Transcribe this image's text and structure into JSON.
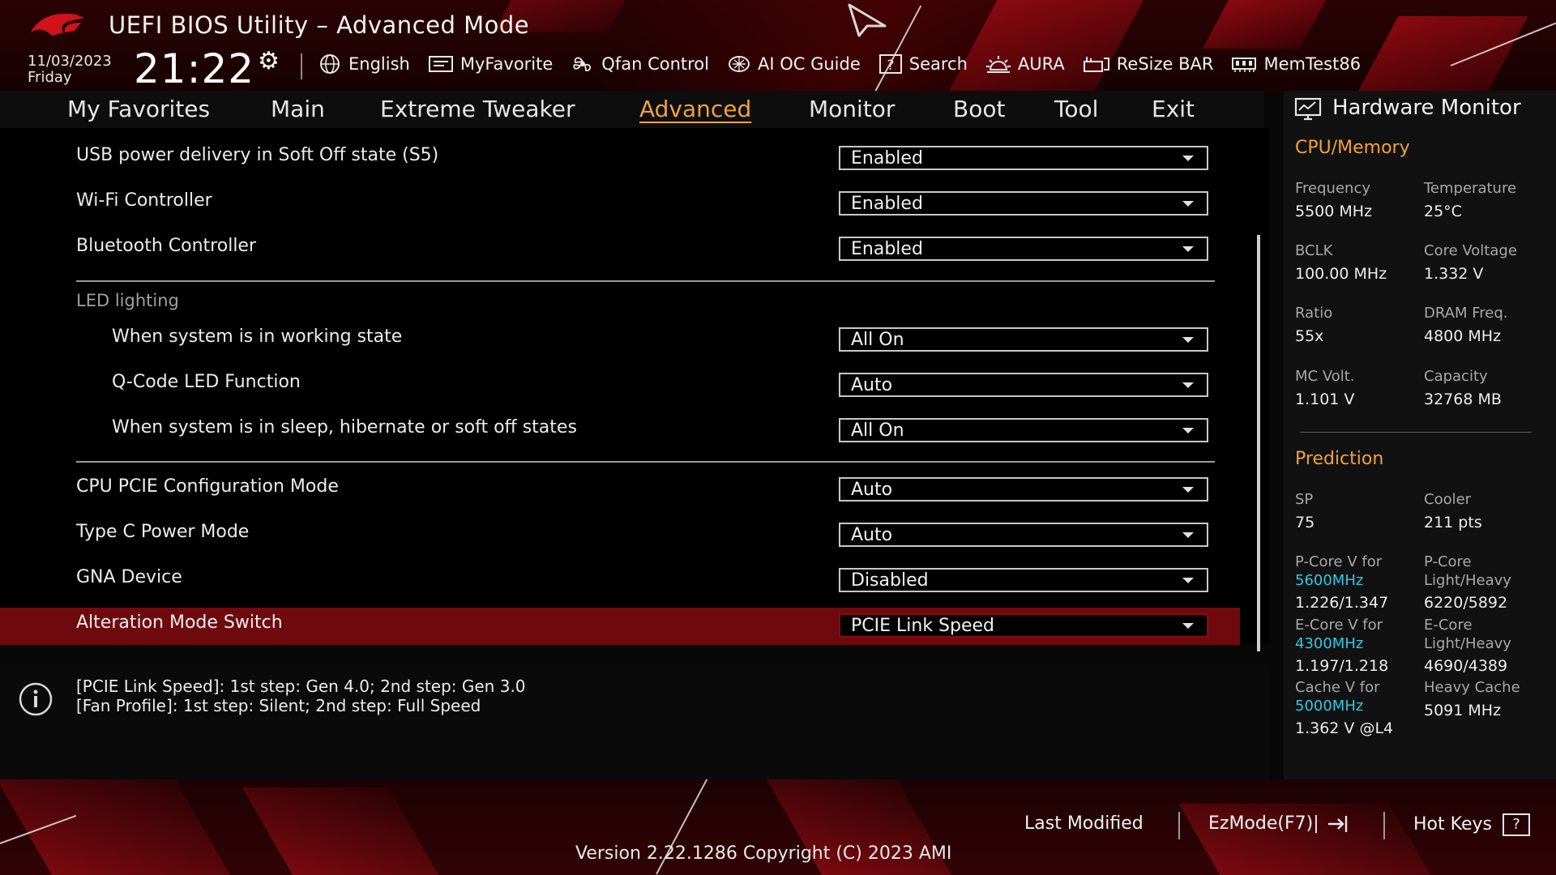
{
  "header": {
    "title": "UEFI BIOS Utility – Advanced Mode",
    "date": "11/03/2023",
    "day": "Friday",
    "time": "21:22"
  },
  "toolbar": [
    {
      "label": "English",
      "icon": "globe-icon"
    },
    {
      "label": "MyFavorite",
      "icon": "favorite-icon"
    },
    {
      "label": "Qfan Control",
      "icon": "fan-icon"
    },
    {
      "label": "AI OC Guide",
      "icon": "ai-chip-icon"
    },
    {
      "label": "Search",
      "icon": "search-icon"
    },
    {
      "label": "AURA",
      "icon": "aura-icon"
    },
    {
      "label": "ReSize BAR",
      "icon": "resize-bar-icon"
    },
    {
      "label": "MemTest86",
      "icon": "memory-icon"
    }
  ],
  "tabs": [
    "My Favorites",
    "Main",
    "Extreme Tweaker",
    "Advanced",
    "Monitor",
    "Boot",
    "Tool",
    "Exit"
  ],
  "active_tab": "Advanced",
  "settings": {
    "usb_power": {
      "label": "USB power delivery in Soft Off state (S5)",
      "value": "Enabled"
    },
    "wifi": {
      "label": "Wi-Fi Controller",
      "value": "Enabled"
    },
    "bluetooth": {
      "label": "Bluetooth Controller",
      "value": "Enabled"
    },
    "led_section": "LED lighting",
    "led_working": {
      "label": "When system is in working state",
      "value": "All On"
    },
    "qcode_led": {
      "label": "Q-Code LED Function",
      "value": "Auto"
    },
    "led_sleep": {
      "label": "When system is in sleep, hibernate or soft off states",
      "value": "All On"
    },
    "cpu_pcie": {
      "label": "CPU PCIE Configuration Mode",
      "value": "Auto"
    },
    "typec_power": {
      "label": "Type C Power Mode",
      "value": "Auto"
    },
    "gna": {
      "label": "GNA Device",
      "value": "Disabled"
    },
    "alteration": {
      "label": "Alteration Mode Switch",
      "value": "PCIE Link Speed"
    }
  },
  "info": [
    "[PCIE Link Speed]: 1st step: Gen 4.0; 2nd step: Gen 3.0",
    "[Fan Profile]: 1st step: Silent; 2nd step: Full Speed"
  ],
  "hardware_monitor": {
    "title": "Hardware Monitor",
    "cpu_memory": {
      "title": "CPU/Memory",
      "frequency": {
        "label": "Frequency",
        "value": "5500 MHz"
      },
      "temperature": {
        "label": "Temperature",
        "value": "25°C"
      },
      "bclk": {
        "label": "BCLK",
        "value": "100.00 MHz"
      },
      "core_voltage": {
        "label": "Core Voltage",
        "value": "1.332 V"
      },
      "ratio": {
        "label": "Ratio",
        "value": "55x"
      },
      "dram_freq": {
        "label": "DRAM Freq.",
        "value": "4800 MHz"
      },
      "mc_volt": {
        "label": "MC Volt.",
        "value": "1.101 V"
      },
      "capacity": {
        "label": "Capacity",
        "value": "32768 MB"
      }
    },
    "prediction": {
      "title": "Prediction",
      "sp": {
        "label": "SP",
        "value": "75"
      },
      "cooler": {
        "label": "Cooler",
        "value": "211 pts"
      },
      "pcore_v": {
        "label": "P-Core V for",
        "freq": "5600MHz",
        "value": "1.226/1.347"
      },
      "pcore_lh": {
        "label1": "P-Core",
        "label2": "Light/Heavy",
        "value": "6220/5892"
      },
      "ecore_v": {
        "label": "E-Core V for",
        "freq": "4300MHz",
        "value": "1.197/1.218"
      },
      "ecore_lh": {
        "label1": "E-Core",
        "label2": "Light/Heavy",
        "value": "4690/4389"
      },
      "cache_v": {
        "label": "Cache V for",
        "freq": "5000MHz",
        "value": "1.362 V @L4"
      },
      "heavy_cache": {
        "label": "Heavy Cache",
        "value": "5091 MHz"
      }
    }
  },
  "footer": {
    "last_modified": "Last Modified",
    "ezmode": "EzMode(F7)|",
    "hotkeys": "Hot Keys",
    "hotkeys_glyph": "?",
    "version": "Version 2.22.1286 Copyright (C) 2023 AMI"
  },
  "colors": {
    "accent": "#f0a23a",
    "highlight_row": "#6e0a0e",
    "cyan": "#2ec9e6",
    "brand_red": "#c0101a"
  }
}
